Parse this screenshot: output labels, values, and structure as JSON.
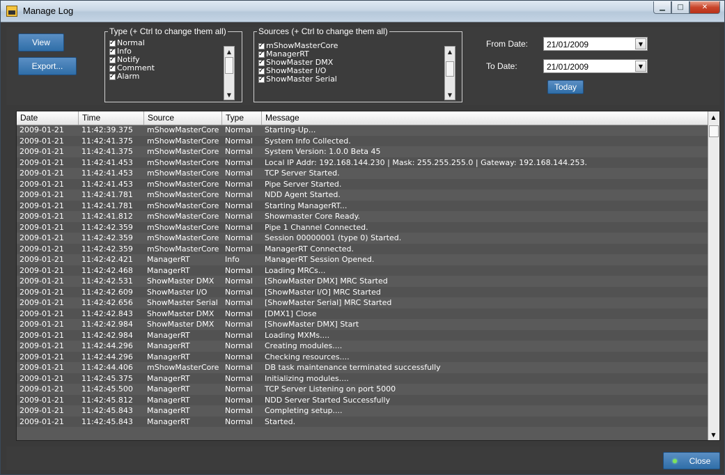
{
  "window": {
    "title": "Manage Log"
  },
  "toolbar": {
    "view_label": "View",
    "export_label": "Export..."
  },
  "type_filter": {
    "legend": "Type (+ Ctrl to change them all)",
    "items": [
      "Normal",
      "Info",
      "Notify",
      "Comment",
      "Alarm"
    ]
  },
  "sources_filter": {
    "legend": "Sources (+ Ctrl to change them all)",
    "items": [
      "mShowMasterCore",
      "ManagerRT",
      "ShowMaster DMX",
      "ShowMaster I/O",
      "ShowMaster Serial"
    ]
  },
  "dates": {
    "from_label": "From Date:",
    "from_value": "21/01/2009",
    "to_label": "To Date:",
    "to_value": "21/01/2009",
    "today_label": "Today"
  },
  "grid": {
    "columns": [
      "Date",
      "Time",
      "Source",
      "Type",
      "Message"
    ],
    "rows": [
      [
        "2009-01-21",
        "11:42:39.375",
        "mShowMasterCore",
        "Normal",
        "Starting-Up..."
      ],
      [
        "2009-01-21",
        "11:42:41.375",
        "mShowMasterCore",
        "Normal",
        "System Info Collected."
      ],
      [
        "2009-01-21",
        "11:42:41.375",
        "mShowMasterCore",
        "Normal",
        "System Version: 1.0.0 Beta 45"
      ],
      [
        "2009-01-21",
        "11:42:41.453",
        "mShowMasterCore",
        "Normal",
        "Local IP Addr: 192.168.144.230 | Mask: 255.255.255.0 | Gateway: 192.168.144.253."
      ],
      [
        "2009-01-21",
        "11:42:41.453",
        "mShowMasterCore",
        "Normal",
        "TCP Server Started."
      ],
      [
        "2009-01-21",
        "11:42:41.453",
        "mShowMasterCore",
        "Normal",
        "Pipe Server Started."
      ],
      [
        "2009-01-21",
        "11:42:41.781",
        "mShowMasterCore",
        "Normal",
        "NDD Agent Started."
      ],
      [
        "2009-01-21",
        "11:42:41.781",
        "mShowMasterCore",
        "Normal",
        "Starting ManagerRT..."
      ],
      [
        "2009-01-21",
        "11:42:41.812",
        "mShowMasterCore",
        "Normal",
        "Showmaster Core Ready."
      ],
      [
        "2009-01-21",
        "11:42:42.359",
        "mShowMasterCore",
        "Normal",
        "Pipe 1 Channel Connected."
      ],
      [
        "2009-01-21",
        "11:42:42.359",
        "mShowMasterCore",
        "Normal",
        "Session 00000001 (type 0) Started."
      ],
      [
        "2009-01-21",
        "11:42:42.359",
        "mShowMasterCore",
        "Normal",
        "ManagerRT Connected."
      ],
      [
        "2009-01-21",
        "11:42:42.421",
        "ManagerRT",
        "Info",
        "ManagerRT Session Opened."
      ],
      [
        "2009-01-21",
        "11:42:42.468",
        "ManagerRT",
        "Normal",
        "Loading MRCs..."
      ],
      [
        "2009-01-21",
        "11:42:42.531",
        "ShowMaster DMX",
        "Normal",
        "[ShowMaster DMX] MRC Started"
      ],
      [
        "2009-01-21",
        "11:42:42.609",
        "ShowMaster I/O",
        "Normal",
        "[ShowMaster I/O] MRC Started"
      ],
      [
        "2009-01-21",
        "11:42:42.656",
        "ShowMaster Serial",
        "Normal",
        "[ShowMaster Serial] MRC Started"
      ],
      [
        "2009-01-21",
        "11:42:42.843",
        "ShowMaster DMX",
        "Normal",
        "[DMX1] Close"
      ],
      [
        "2009-01-21",
        "11:42:42.984",
        "ShowMaster DMX",
        "Normal",
        "[ShowMaster DMX] Start"
      ],
      [
        "2009-01-21",
        "11:42:42.984",
        "ManagerRT",
        "Normal",
        "Loading MXMs...."
      ],
      [
        "2009-01-21",
        "11:42:44.296",
        "ManagerRT",
        "Normal",
        "Creating modules...."
      ],
      [
        "2009-01-21",
        "11:42:44.296",
        "ManagerRT",
        "Normal",
        "Checking resources...."
      ],
      [
        "2009-01-21",
        "11:42:44.406",
        "mShowMasterCore",
        "Normal",
        "DB task maintenance terminated successfully"
      ],
      [
        "2009-01-21",
        "11:42:45.375",
        "ManagerRT",
        "Normal",
        "Initializing modules...."
      ],
      [
        "2009-01-21",
        "11:42:45.500",
        "ManagerRT",
        "Normal",
        "TCP Server Listening on port 5000"
      ],
      [
        "2009-01-21",
        "11:42:45.812",
        "ManagerRT",
        "Normal",
        "NDD Server Started Successfully"
      ],
      [
        "2009-01-21",
        "11:42:45.843",
        "ManagerRT",
        "Normal",
        "Completing setup...."
      ],
      [
        "2009-01-21",
        "11:42:45.843",
        "ManagerRT",
        "Normal",
        "Started."
      ]
    ]
  },
  "footer": {
    "close_label": "Close"
  }
}
